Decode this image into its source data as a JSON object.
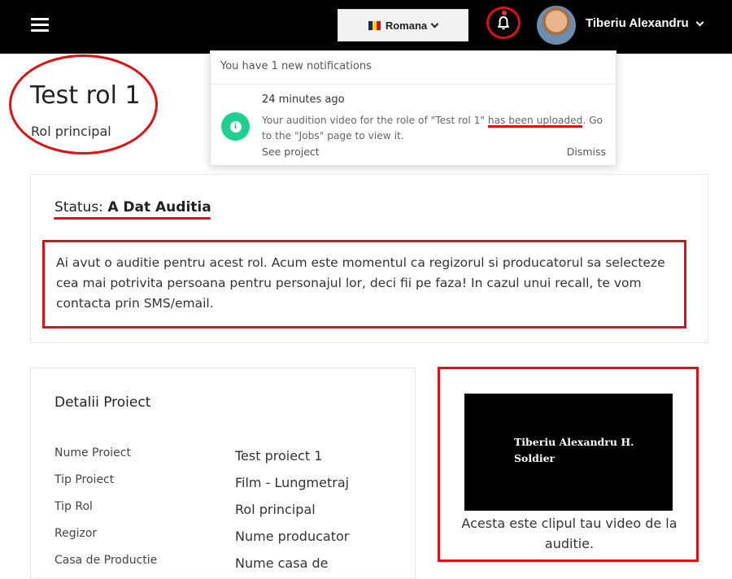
{
  "header": {
    "language": "Romana",
    "user_name": "Tiberiu Alexandru",
    "flag_colors": [
      "#002b7f",
      "#fcd116",
      "#ce1126"
    ]
  },
  "notifications": {
    "heading": "You have 1 new notifications",
    "item": {
      "time": "24 minutes ago",
      "text_before": "Your audition video for the role of \"Test rol 1\" ",
      "text_highlight": "has been uploaded",
      "text_after": ". Go to the \"Jobs\" page to view it.",
      "see_project": "See project",
      "dismiss": "Dismiss"
    }
  },
  "role": {
    "title": "Test rol 1",
    "subtitle": "Rol principal"
  },
  "status": {
    "label": "Status:",
    "value": "A Dat Auditia",
    "message": "Ai avut o auditie pentru acest rol. Acum este momentul ca regizorul si producatorul sa selecteze cea mai potrivita persoana pentru personajul lor, deci fii pe faza! In cazul unui recall, te vom contacta prin SMS/email."
  },
  "details": {
    "title": "Detalii Proiect",
    "rows": [
      {
        "label": "Nume Proiect",
        "value": "Test proiect 1"
      },
      {
        "label": "Tip Proiect",
        "value": "Film - Lungmetraj"
      },
      {
        "label": "Tip Rol",
        "value": "Rol principal"
      },
      {
        "label": "Regizor",
        "value": "Nume producator"
      },
      {
        "label": "Casa de Productie",
        "value": "Nume casa de"
      }
    ]
  },
  "video": {
    "line1": "Tiberiu Alexandru H.",
    "line2": "Soldier",
    "caption": "Acesta este clipul tau video de la auditie."
  },
  "colors": {
    "accent_red": "#e01010",
    "notif_green": "#1fcf8f",
    "topbar": "#000000"
  }
}
